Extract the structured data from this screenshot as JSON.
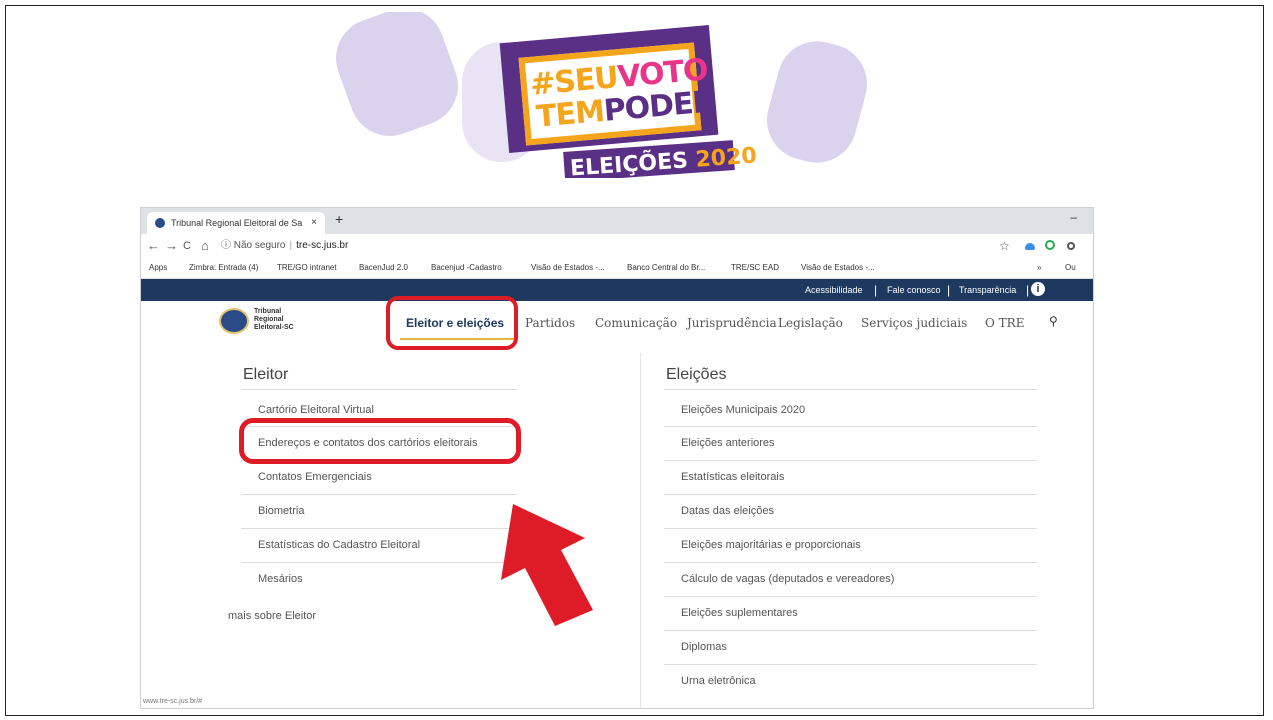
{
  "banner": {
    "line1_a": "#SEU",
    "line1_b": "VOTO",
    "line2_a": "TEM",
    "line2_b": "PODER",
    "line3_a": "ELEIÇÕES",
    "line3_b": "2020"
  },
  "browser": {
    "tab_title": "Tribunal Regional Eleitoral de Sa",
    "tab_close": "×",
    "new_tab": "+",
    "minimize": "–",
    "nav_back": "←",
    "nav_forward": "→",
    "nav_reload": "C",
    "nav_home": "⌂",
    "security_label": "ⓘ Não seguro",
    "separator": "|",
    "url": "tre-sc.jus.br",
    "star": "☆"
  },
  "bookmarks": [
    "Apps",
    "Zimbra: Entrada (4)",
    "TRE/GO intranet",
    "BacenJud 2.0",
    "Bacenjud -Cadastro",
    "Visão de Estados -...",
    "Banco Central do Br...",
    "TRE/SC EAD",
    "Visão de Estados -...",
    "»",
    "Ou"
  ],
  "site": {
    "top_links": [
      "Acessibilidade",
      "Fale conosco",
      "Transparência"
    ],
    "pipe": "|",
    "info": "i",
    "logo_lines": [
      "Tribunal",
      "Regional",
      "Eleitoral-SC"
    ],
    "menu": [
      "Eleitor e eleições",
      "Partidos",
      "Comunicação",
      "Jurisprudência",
      "Legislação",
      "Serviços judiciais",
      "O TRE"
    ],
    "search_icon": "⚲",
    "left_title": "Eleitor",
    "left_items": [
      "Cartório Eleitoral Virtual",
      "Endereços e contatos dos cartórios eleitorais",
      "Contatos Emergenciais",
      "Biometria",
      "Estatísticas do Cadastro Eleitoral",
      "Mesários"
    ],
    "left_more": "mais sobre Eleitor",
    "right_title": "Eleições",
    "right_items": [
      "Eleições Municipais 2020",
      "Eleições anteriores",
      "Estatísticas eleitorais",
      "Datas das eleições",
      "Eleições majoritárias e proporcionais",
      "Cálculo de vagas (deputados e vereadores)",
      "Eleições suplementares",
      "Diplomas",
      "Urna eletrônica"
    ],
    "status_url": "www.tre-sc.jus.br/#"
  },
  "colors": {
    "highlight": "#dd1c28",
    "navy": "#1d3960",
    "purple": "#5a2f86",
    "orange": "#f4a51c",
    "pink": "#e8358a"
  }
}
